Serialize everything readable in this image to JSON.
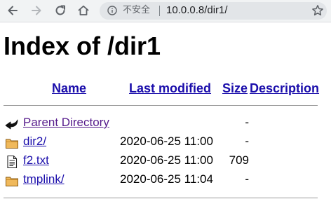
{
  "browser": {
    "security_text": "不安全",
    "url": "10.0.0.8/dir1/"
  },
  "page": {
    "title": "Index of /dir1",
    "columns": {
      "name": "Name",
      "last_modified": "Last modified",
      "size": "Size",
      "description": "Description"
    },
    "rows": [
      {
        "icon": "back-icon",
        "name": "Parent Directory",
        "modified": "",
        "size": "-",
        "visited": true
      },
      {
        "icon": "folder-icon",
        "name": "dir2/",
        "modified": "2020-06-25 11:00",
        "size": "-"
      },
      {
        "icon": "file-text-icon",
        "name": "f2.txt",
        "modified": "2020-06-25 11:00",
        "size": "709"
      },
      {
        "icon": "folder-icon",
        "name": "tmplink/",
        "modified": "2020-06-25 11:04",
        "size": "-"
      }
    ]
  },
  "colors": {
    "link": "#1a0dab",
    "visited": "#551a8b",
    "toolbar_bg": "#f1f3f4",
    "omnibox_bg": "#e2e5e8"
  }
}
